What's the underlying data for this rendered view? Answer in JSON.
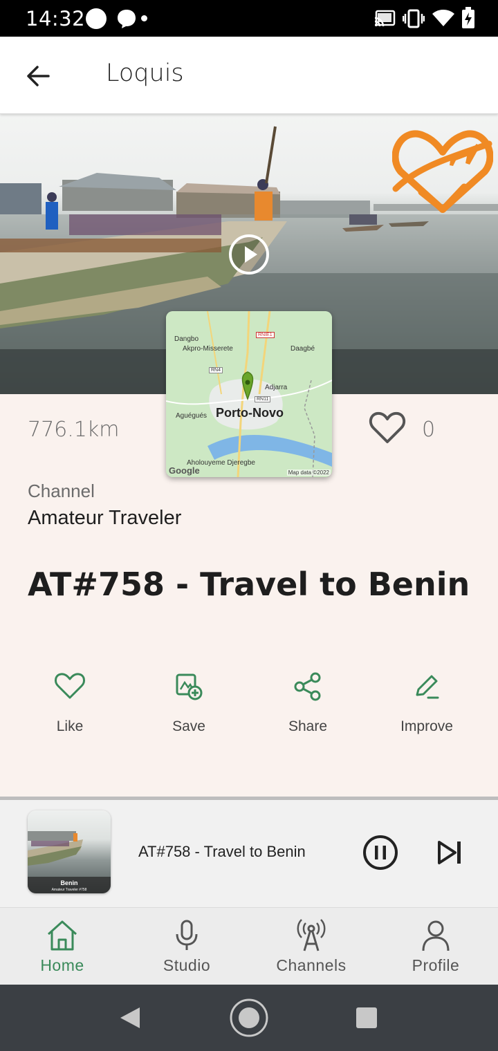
{
  "status_bar": {
    "time": "14:32",
    "icons": [
      "notification-dot-icon",
      "messenger-icon",
      "small-dot-icon",
      "cast-icon",
      "vibrate-icon",
      "wifi-icon",
      "battery-charging-icon"
    ]
  },
  "app_bar": {
    "title": "Loquis",
    "back_icon": "arrow-left-icon"
  },
  "hero": {
    "play_icon": "play-circle-icon",
    "logo_icon": "heart-plane-logo-icon"
  },
  "map": {
    "city": "Porto-Novo",
    "labels": {
      "dangbo": "Dangbo",
      "akpro": "Akpro-Misserete",
      "daagbe": "Daagbé",
      "adjarra": "Adjarra",
      "aguegues": "Aguégués",
      "aholouyeme": "Aholouyeme Djeregbe"
    },
    "roads": {
      "rnie1": "RNIE1",
      "rn4": "RN4",
      "rn11": "RN11"
    },
    "google": "Google",
    "attribution": "Map data ©2022"
  },
  "details": {
    "distance": "776.1km",
    "like_count": "0",
    "channel_label": "Channel",
    "channel_name": "Amateur Traveler",
    "episode_title": "AT#758 - Travel to Benin"
  },
  "actions": [
    {
      "label": "Like",
      "icon": "heart-outline-icon"
    },
    {
      "label": "Save",
      "icon": "save-to-library-icon"
    },
    {
      "label": "Share",
      "icon": "share-icon"
    },
    {
      "label": "Improve",
      "icon": "edit-pencil-icon"
    }
  ],
  "player": {
    "title": "AT#758 - Travel to Benin",
    "thumb_title": "Benin",
    "thumb_subtitle": "Amateur Traveler #758",
    "pause_icon": "pause-circle-icon",
    "next_icon": "skip-next-icon"
  },
  "bottom_nav": [
    {
      "label": "Home",
      "icon": "home-icon",
      "active": true
    },
    {
      "label": "Studio",
      "icon": "microphone-icon",
      "active": false
    },
    {
      "label": "Channels",
      "icon": "broadcast-tower-icon",
      "active": false
    },
    {
      "label": "Profile",
      "icon": "person-icon",
      "active": false
    }
  ],
  "colors": {
    "accent_green": "#3a8a5a",
    "content_background": "#faf2ee",
    "brand_orange": "#f08a24"
  }
}
